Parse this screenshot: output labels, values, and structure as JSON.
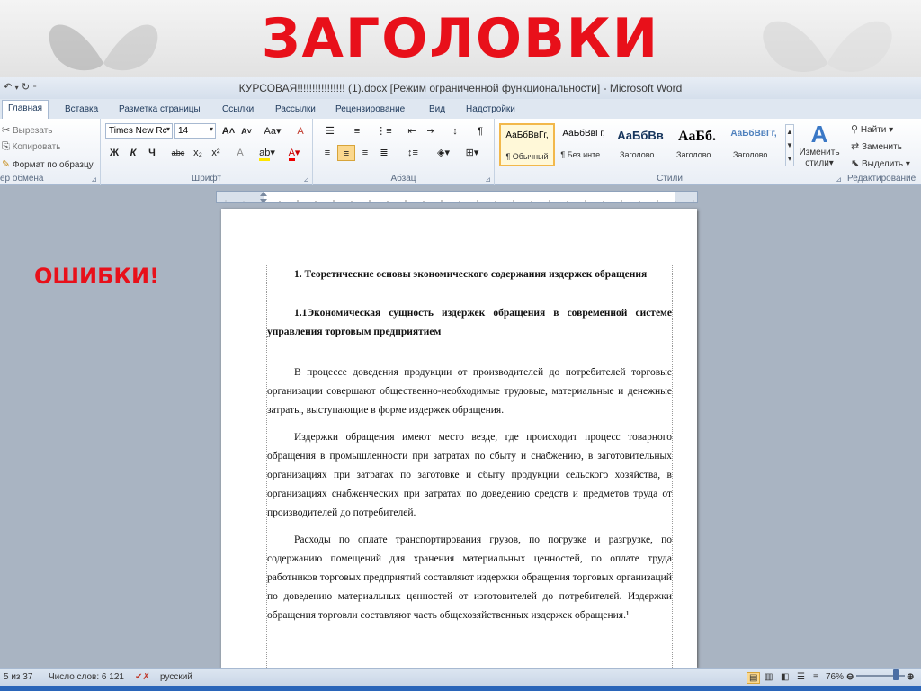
{
  "slide": {
    "title": "ЗАГОЛОВКИ",
    "callout": "ОШИБКИ!"
  },
  "window": {
    "title": "КУРСОВАЯ!!!!!!!!!!!!!!!! (1).docx [Режим ограниченной функциональности]  -  Microsoft Word",
    "qat_icons": [
      "undo-icon",
      "redo-icon"
    ]
  },
  "tabs": [
    "Главная",
    "Вставка",
    "Разметка страницы",
    "Ссылки",
    "Рассылки",
    "Рецензирование",
    "Вид",
    "Надстройки"
  ],
  "ribbon": {
    "clipboard": {
      "cut": "Вырезать",
      "copy": "Копировать",
      "format_painter": "Формат по образцу",
      "label": "ер обмена"
    },
    "font": {
      "font_name": "Times New Rc",
      "font_size": "14",
      "label": "Шрифт",
      "bold": "Ж",
      "italic": "К",
      "underline": "Ч",
      "strike": "abc",
      "subscript": "x₂",
      "superscript": "x²",
      "grow": "A",
      "shrink": "A",
      "case": "Aa",
      "clear": "A"
    },
    "paragraph": {
      "label": "Абзац"
    },
    "styles": {
      "label": "Стили",
      "items": [
        {
          "sample": "АаБбВвГг,",
          "name": "¶ Обычный"
        },
        {
          "sample": "АаБбВвГг,",
          "name": "¶ Без инте..."
        },
        {
          "sample": "АаБбВв",
          "name": "Заголово..."
        },
        {
          "sample": "АаБб.",
          "name": "Заголово..."
        },
        {
          "sample": "АаБбВвГг,",
          "name": "Заголово..."
        }
      ],
      "change_styles": "Изменить стили"
    },
    "editing": {
      "label": "Редактирование",
      "find": "Найти",
      "replace": "Заменить",
      "select": "Выделить"
    }
  },
  "document": {
    "heading1": "1.   Теоретические   основы   экономического   содержания   издержек обращения",
    "heading2": "1.1Экономическая   сущность   издержек   обращения   в      современной системе  управления торговым предприятием",
    "paragraphs": [
      "В процессе доведения продукции от производителей до потребителей торговые организации совершают общественно-необходимые трудовые, материальные и денежные затраты, выступающие в форме  издержек обращения.",
      "Издержки обращения имеют место везде, где происходит процесс товарного обращения в промышленности при затратах по сбыту и снабжению, в заготовительных организациях при затратах по заготовке и сбыту продукции сельского хозяйства, в организациях снабженческих при затратах по доведению средств и предметов труда от производителей до потребителей.",
      "Расходы по оплате транспортирования грузов, по погрузке и разгрузке, по содержанию помещений для хранения материальных ценностей, по оплате труда работников торговых предприятий составляют издержки обращения торговых организаций по доведению материальных ценностей от изготовителей до потребителей. Издержки обращения торговли составляют часть общехозяйственных издержек обращения.¹"
    ]
  },
  "statusbar": {
    "page": "5 из 37",
    "words": "Число слов: 6 121",
    "language": "русский",
    "zoom": "76%"
  }
}
